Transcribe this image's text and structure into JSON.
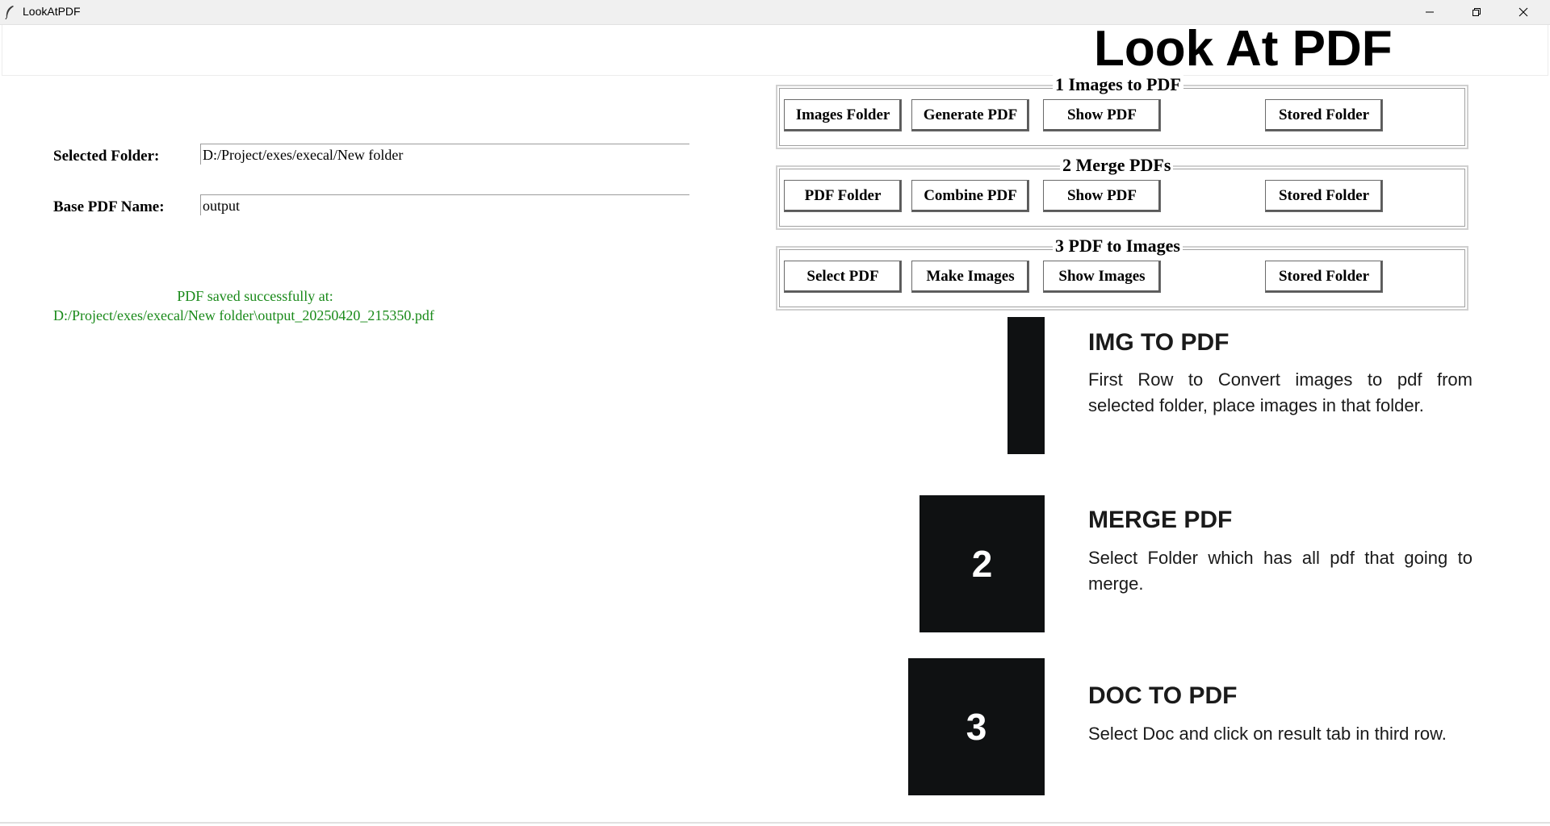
{
  "window": {
    "title": "LookAtPDF"
  },
  "header": {
    "title": "Look At PDF"
  },
  "form": {
    "selected_folder_label": "Selected Folder:",
    "selected_folder_value": "D:/Project/exes/execal/New folder",
    "base_pdf_label": "Base PDF Name:",
    "base_pdf_value": "output"
  },
  "status": {
    "line1": "PDF saved successfully at:",
    "line2": "D:/Project/exes/execal/New folder\\output_20250420_215350.pdf",
    "color": "#1a8a1a"
  },
  "groups": [
    {
      "title": "1 Images to PDF",
      "buttons": [
        "Images Folder",
        "Generate PDF",
        "Show PDF",
        "Stored Folder"
      ]
    },
    {
      "title": "2 Merge PDFs",
      "buttons": [
        "PDF Folder",
        "Combine PDF",
        "Show PDF",
        "Stored Folder"
      ]
    },
    {
      "title": "3 PDF to Images",
      "buttons": [
        "Select PDF",
        "Make Images",
        "Show Images",
        "Stored Folder"
      ]
    }
  ],
  "info": [
    {
      "number": "",
      "heading": "IMG TO PDF",
      "text": "First Row to Convert images to pdf from selected folder, place images in that folder."
    },
    {
      "number": "2",
      "heading": "MERGE PDF",
      "text": "Select Folder which has all pdf that going to merge."
    },
    {
      "number": "3",
      "heading": "DOC TO PDF",
      "text": "Select Doc and click on result tab in third row."
    }
  ]
}
